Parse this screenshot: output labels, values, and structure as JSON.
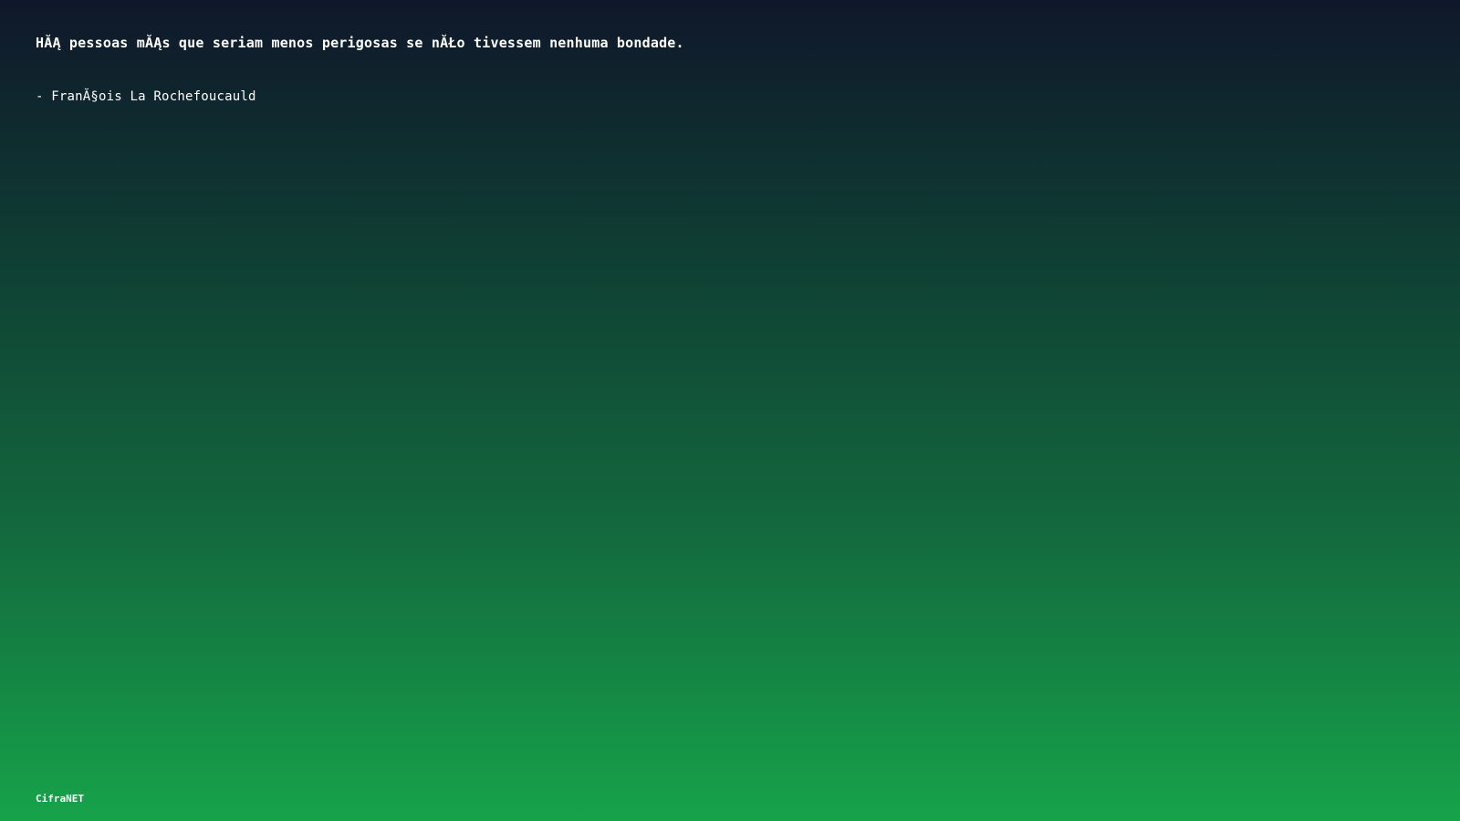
{
  "quote": {
    "text": "HĂĄ pessoas mĂĄs que seriam menos perigosas se nĂŁo tivessem nenhuma bondade.",
    "author": "- FranĂ§ois La Rochefoucauld"
  },
  "footer": {
    "brand": "CifraNET"
  }
}
